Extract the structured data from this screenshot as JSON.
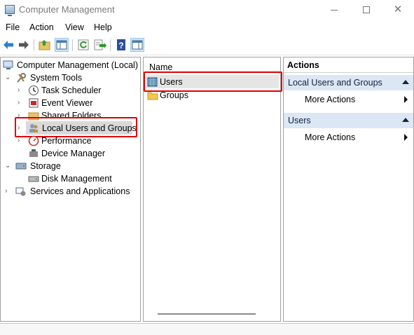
{
  "window": {
    "title": "Computer Management"
  },
  "menu": {
    "file": "File",
    "action": "Action",
    "view": "View",
    "help": "Help"
  },
  "toolbar": {
    "buttons": [
      "back-arrow-icon",
      "forward-arrow-icon",
      "up-folder-icon",
      "show-hide-tree-icon",
      "refresh-icon",
      "export-list-icon",
      "help-icon",
      "show-hide-action-pane-icon"
    ]
  },
  "tree": {
    "root": "Computer Management (Local)",
    "system_tools": "System Tools",
    "task_scheduler": "Task Scheduler",
    "event_viewer": "Event Viewer",
    "shared_folders": "Shared Folders",
    "local_users_groups": "Local Users and Groups",
    "performance": "Performance",
    "device_manager": "Device Manager",
    "storage": "Storage",
    "disk_management": "Disk Management",
    "services_apps": "Services and Applications"
  },
  "list": {
    "column_name": "Name",
    "items": [
      "Users",
      "Groups"
    ]
  },
  "actions": {
    "title": "Actions",
    "section1": "Local Users and Groups",
    "section1_item": "More Actions",
    "section2": "Users",
    "section2_item": "More Actions"
  },
  "colors": {
    "highlight_red": "#e00000",
    "section_blue": "#dbe7f4",
    "selection_gray": "#d9d9d9"
  }
}
